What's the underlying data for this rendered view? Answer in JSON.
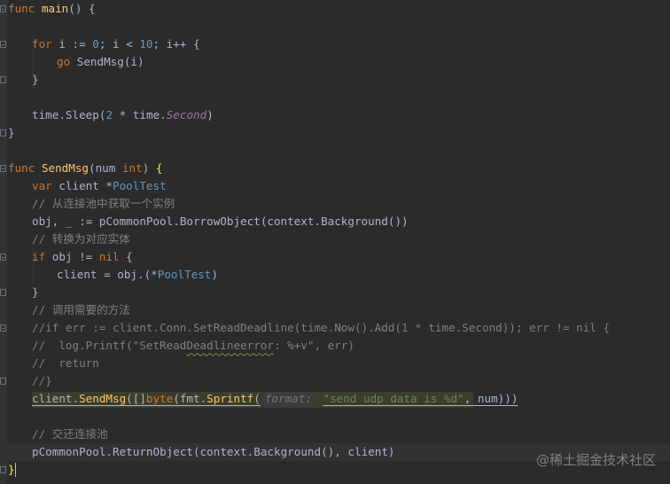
{
  "code": {
    "l1": [
      "func",
      " ",
      "main",
      "() {"
    ],
    "l3": [
      "for",
      " i := ",
      "0",
      "; i < ",
      "10",
      "; i++ {"
    ],
    "l4": [
      "go",
      " SendMsg(i)"
    ],
    "l5": [
      "}"
    ],
    "l7": [
      "time.",
      "Sleep",
      "(",
      "2",
      " * time.",
      "Second",
      ")"
    ],
    "l8": [
      "}"
    ],
    "l10": [
      "func",
      " ",
      "SendMsg",
      "(num ",
      "int",
      ") ",
      "{"
    ],
    "l11": [
      "var",
      " client *",
      "PoolTest"
    ],
    "l12": "// 从连接池中获取一个实例",
    "l13": [
      "obj, _ := pCommonPool.",
      "BorrowObject",
      "(context.",
      "Background",
      "())"
    ],
    "l14": "// 转换为对应实体",
    "l15": [
      "if",
      " obj != ",
      "nil",
      " {"
    ],
    "l16": [
      "client = obj.(*",
      "PoolTest",
      ")"
    ],
    "l17": [
      "}"
    ],
    "l18": "// 调用需要的方法",
    "l19": "//if err := client.Conn.SetReadDeadline(time.Now().Add(1 * time.Second)); err != nil {",
    "l20": [
      "//  log.Printf(\"SetRead",
      "Deadlineerror",
      ": %+v\", err)"
    ],
    "l21": "//  return",
    "l22": "//}",
    "l23": [
      "client.",
      "SendMsg",
      "([]",
      "byte",
      "(fmt.",
      "Sprintf",
      "(",
      "format:",
      " ",
      "\"send udp data is %d\"",
      ", num)))"
    ],
    "l25": "// 交还连接池",
    "l26": [
      "pCommonPool.",
      "ReturnObject",
      "(context.",
      "Background",
      "(), client)"
    ],
    "l27": [
      "}"
    ]
  },
  "watermark": "@稀土掘金技术社区",
  "colors": {
    "background": "#2b2b2b",
    "keyword": "#cc7832",
    "function": "#ffc66d",
    "number": "#6897bb",
    "comment": "#808080",
    "string": "#6a8759",
    "italic_field": "#9876aa",
    "text": "#a9b7c6"
  }
}
